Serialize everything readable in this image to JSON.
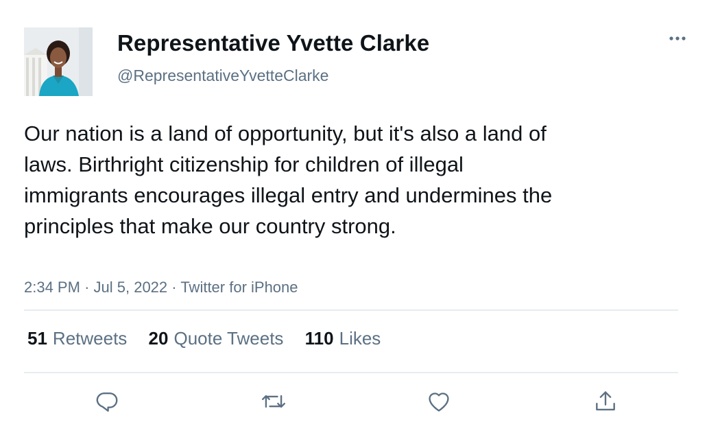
{
  "author": {
    "display_name": "Representative Yvette Clarke",
    "handle": "@RepresentativeYvetteClarke"
  },
  "tweet": {
    "text": "Our nation is a land of opportunity, but it's also a land of laws. Birthright citizenship for children of illegal immigrants encourages illegal entry and undermines the principles that make our country strong.",
    "time": "2:34 PM",
    "date": "Jul 5, 2022",
    "source": "Twitter for iPhone",
    "separator": "·"
  },
  "stats": {
    "retweets_count": "51",
    "retweets_label": "Retweets",
    "quotes_count": "20",
    "quotes_label": "Quote Tweets",
    "likes_count": "110",
    "likes_label": "Likes"
  },
  "icons": {
    "more": "more-horizontal-icon",
    "reply": "reply-icon",
    "retweet": "retweet-icon",
    "like": "heart-icon",
    "share": "share-icon"
  },
  "colors": {
    "text_primary": "#0f1419",
    "text_secondary": "#5b7083",
    "divider": "#e6ecf0",
    "icon": "#5b7083"
  }
}
